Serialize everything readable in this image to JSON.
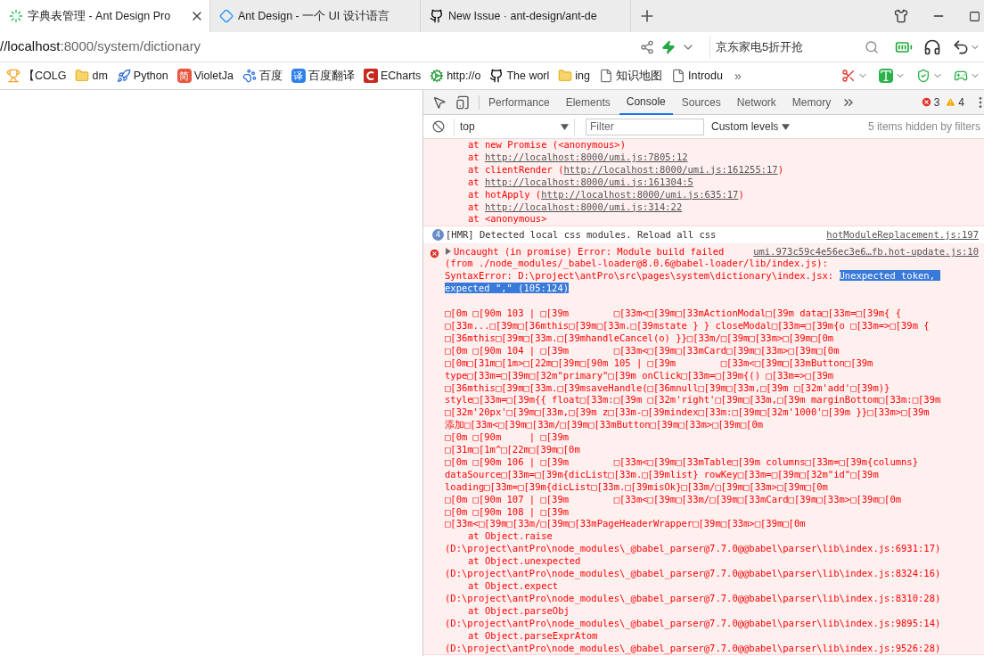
{
  "browser": {
    "tabs": [
      {
        "title": "字典表管理 - Ant Design Pro",
        "selected": true
      },
      {
        "title": "Ant Design - 一个 UI 设计语言",
        "selected": false
      },
      {
        "title": "New Issue · ant-design/ant-de",
        "selected": false
      }
    ],
    "address": [
      {
        "text": "//localhost",
        "emphasis": true
      },
      {
        "text": ":8000/system/dictionary",
        "emphasis": false
      }
    ],
    "search": {
      "value": "京东家电5折开抢"
    },
    "bookmarks": [
      {
        "label": "【COLG"
      },
      {
        "label": "dm"
      },
      {
        "label": "Python"
      },
      {
        "label": "VioletJa",
        "icon_text": "简"
      },
      {
        "label": "百度"
      },
      {
        "label": "百度翻译",
        "icon_text": "译"
      },
      {
        "label": "ECharts"
      },
      {
        "label": "http://o"
      },
      {
        "label": "The worl"
      },
      {
        "label": "ing"
      },
      {
        "label": "知识地图"
      },
      {
        "label": "Introdu"
      }
    ],
    "more_button": "»"
  },
  "devtools": {
    "tabs": [
      {
        "label": "Performance",
        "selected": false
      },
      {
        "label": "Elements",
        "selected": false
      },
      {
        "label": "Console",
        "selected": true
      },
      {
        "label": "Sources",
        "selected": false
      },
      {
        "label": "Network",
        "selected": false
      },
      {
        "label": "Memory",
        "selected": false
      }
    ],
    "error_count": "3",
    "warning_count": "4",
    "console_toolbar": {
      "context": "top",
      "filter": {
        "placeholder": "Filter"
      },
      "levels": "Custom levels",
      "hidden_note": "5 items hidden by filters"
    },
    "messages": [
      {
        "kind": "error-tail",
        "lines": [
          {
            "kind": "frame",
            "text": "at new Promise (<anonymous>)"
          },
          {
            "kind": "frame",
            "segments": [
              {
                "text": "at ",
                "link": false,
                "selected": false
              },
              {
                "text": "http://localhost:8000/umi.js:7805:12",
                "link": true,
                "selected": false
              }
            ]
          },
          {
            "kind": "frame",
            "segments": [
              {
                "text": "at clientRender (",
                "link": false,
                "selected": false
              },
              {
                "text": "http://localhost:8000/umi.js:161255:17",
                "link": true,
                "selected": false
              },
              {
                "text": ")",
                "link": false,
                "selected": false
              }
            ]
          },
          {
            "kind": "frame",
            "segments": [
              {
                "text": "at ",
                "link": false,
                "selected": false
              },
              {
                "text": "http://localhost:8000/umi.js:161304:5",
                "link": true,
                "selected": false
              }
            ]
          },
          {
            "kind": "frame",
            "segments": [
              {
                "text": "at hotApply (",
                "link": false,
                "selected": false
              },
              {
                "text": "http://localhost:8000/umi.js:635:17",
                "link": true,
                "selected": false
              },
              {
                "text": ")",
                "link": false,
                "selected": false
              }
            ]
          },
          {
            "kind": "frame",
            "segments": [
              {
                "text": "at ",
                "link": false,
                "selected": false
              },
              {
                "text": "http://localhost:8000/umi.js:314:22",
                "link": true,
                "selected": false
              }
            ]
          },
          {
            "kind": "frame",
            "text": "at <anonymous>"
          }
        ]
      },
      {
        "kind": "info",
        "count": "4",
        "text": "[HMR] Detected local css modules. Reload all css",
        "source": "hotModuleReplacement.js:197"
      },
      {
        "kind": "error",
        "expanded": false,
        "text": "Uncaught (in promise) Error: Module build failed",
        "source": "umi.973c59c4e56ec3e6…fb.hot-update.js:10",
        "lines": [
          {
            "kind": "text",
            "text": "(from ./node_modules/_babel-loader@8.0.6@babel-loader/lib/index.js):"
          },
          {
            "kind": "text",
            "segments": [
              {
                "text": "SyntaxError: D:\\project\\antPro\\src\\pages\\system\\dictionary\\index.jsx: ",
                "link": false,
                "selected": false
              },
              {
                "text": "Unexpected token, ",
                "link": false,
                "selected": true
              }
            ]
          },
          {
            "kind": "text",
            "segments": [
              {
                "text": "expected \",\" (105:124)",
                "link": false,
                "selected": true
              }
            ]
          },
          {
            "kind": "code",
            "text": "□[0m □[90m 103 | □[39m        □[33m<□[39m□[33mActionModal□[39m data□[33m=□[39m{ {"
          },
          {
            "kind": "code",
            "text": "□[33m...□[39m□[36mthis□[39m□[33m.□[39mstate } } closeModal□[33m=□[39m{o □[33m=>□[39m {"
          },
          {
            "kind": "code",
            "text": "□[36mthis□[39m□[33m.□[39mhandleCancel(o) }}□[33m/□[39m□[33m>□[39m□[0m"
          },
          {
            "kind": "code",
            "text": "□[0m □[90m 104 | □[39m        □[33m<□[39m□[33mCard□[39m□[33m>□[39m□[0m"
          },
          {
            "kind": "code",
            "text": "□[0m□[31m□[1m>□[22m□[39m□[90m 105 | □[39m        □[33m<□[39m□[33mButton□[39m"
          },
          {
            "kind": "code",
            "text": "type□[33m=□[39m□[32m\"primary\"□[39m onClick□[33m=□[39m{() □[33m=>□[39m"
          },
          {
            "kind": "code",
            "text": "□[36mthis□[39m□[33m.□[39msaveHandle(□[36mnull□[39m□[33m,□[39m □[32m'add'□[39m)}"
          },
          {
            "kind": "code",
            "text": "style□[33m=□[39m{{ float□[33m:□[39m □[32m'right'□[39m□[33m,□[39m marginBottom□[33m:□[39m"
          },
          {
            "kind": "code",
            "text": "□[32m'20px'□[39m□[33m,□[39m z□[33m-□[39mindex□[33m:□[39m□[32m'1000'□[39m }}□[33m>□[39m"
          },
          {
            "kind": "code",
            "text": "添加□[33m<□[39m□[33m/□[39m□[33mButton□[39m□[33m>□[39m□[0m"
          },
          {
            "kind": "code",
            "text": "□[0m □[90m     | □[39m"
          },
          {
            "kind": "code",
            "text": "□[31m□[1m^□[22m□[39m□[0m"
          },
          {
            "kind": "code",
            "text": "□[0m □[90m 106 | □[39m        □[33m<□[39m□[33mTable□[39m columns□[33m=□[39m{columns}"
          },
          {
            "kind": "code",
            "text": "dataSource□[33m=□[39m{dicList□[33m.□[39mlist} rowKey□[33m=□[39m□[32m\"id\"□[39m"
          },
          {
            "kind": "code",
            "text": "loading□[33m=□[39m{dicList□[33m.□[39misOk}□[33m/□[39m□[33m>□[39m□[0m"
          },
          {
            "kind": "code",
            "text": "□[0m □[90m 107 | □[39m        □[33m<□[39m□[33m/□[39m□[33mCard□[39m□[33m>□[39m□[0m"
          },
          {
            "kind": "code",
            "text": "□[0m □[90m 108 | □[39m"
          },
          {
            "kind": "code",
            "text": "□[33m<□[39m□[33m/□[39m□[33mPageHeaderWrapper□[39m□[33m>□[39m□[0m"
          },
          {
            "kind": "frame",
            "text": "at Object.raise"
          },
          {
            "kind": "path",
            "text": "(D:\\project\\antPro\\node_modules\\_@babel_parser@7.7.0@@babel\\parser\\lib\\index.js:6931:17)"
          },
          {
            "kind": "frame",
            "text": "at Object.unexpected"
          },
          {
            "kind": "path",
            "text": "(D:\\project\\antPro\\node_modules\\_@babel_parser@7.7.0@@babel\\parser\\lib\\index.js:8324:16)"
          },
          {
            "kind": "frame",
            "text": "at Object.expect"
          },
          {
            "kind": "path",
            "text": "(D:\\project\\antPro\\node_modules\\_@babel_parser@7.7.0@@babel\\parser\\lib\\index.js:8310:28)"
          },
          {
            "kind": "frame",
            "text": "at Object.parseObj"
          },
          {
            "kind": "path",
            "text": "(D:\\project\\antPro\\node_modules\\_@babel_parser@7.7.0@@babel\\parser\\lib\\index.js:9895:14)"
          },
          {
            "kind": "frame",
            "text": "at Object.parseExprAtom"
          },
          {
            "kind": "path",
            "text": "(D:\\project\\antPro\\node_modules\\_@babel_parser@7.7.0@@babel\\parser\\lib\\index.js:9526:28)"
          }
        ]
      }
    ]
  }
}
